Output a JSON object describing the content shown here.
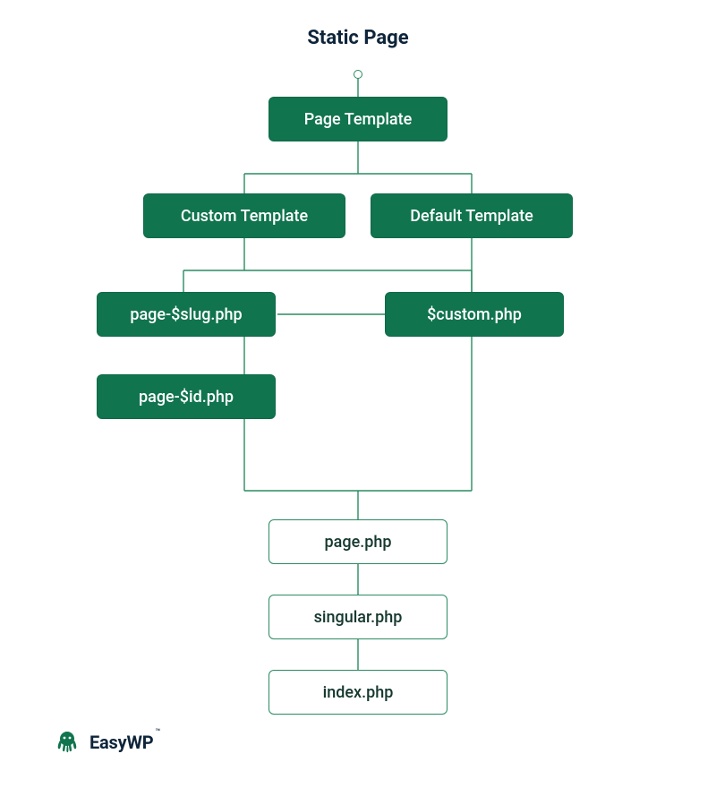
{
  "title": "Static Page",
  "colors": {
    "primary": "#10744e",
    "stroke": "#2a8b62",
    "text_dark": "#0e253b"
  },
  "nodes": {
    "page_template": "Page Template",
    "custom_template": "Custom Template",
    "default_template": "Default Template",
    "page_slug": "page-$slug.php",
    "custom_php": "$custom.php",
    "page_id": "page-$id.php",
    "page_php": "page.php",
    "singular_php": "singular.php",
    "index_php": "index.php"
  },
  "brand": {
    "name": "EasyWP",
    "tm": "™"
  }
}
